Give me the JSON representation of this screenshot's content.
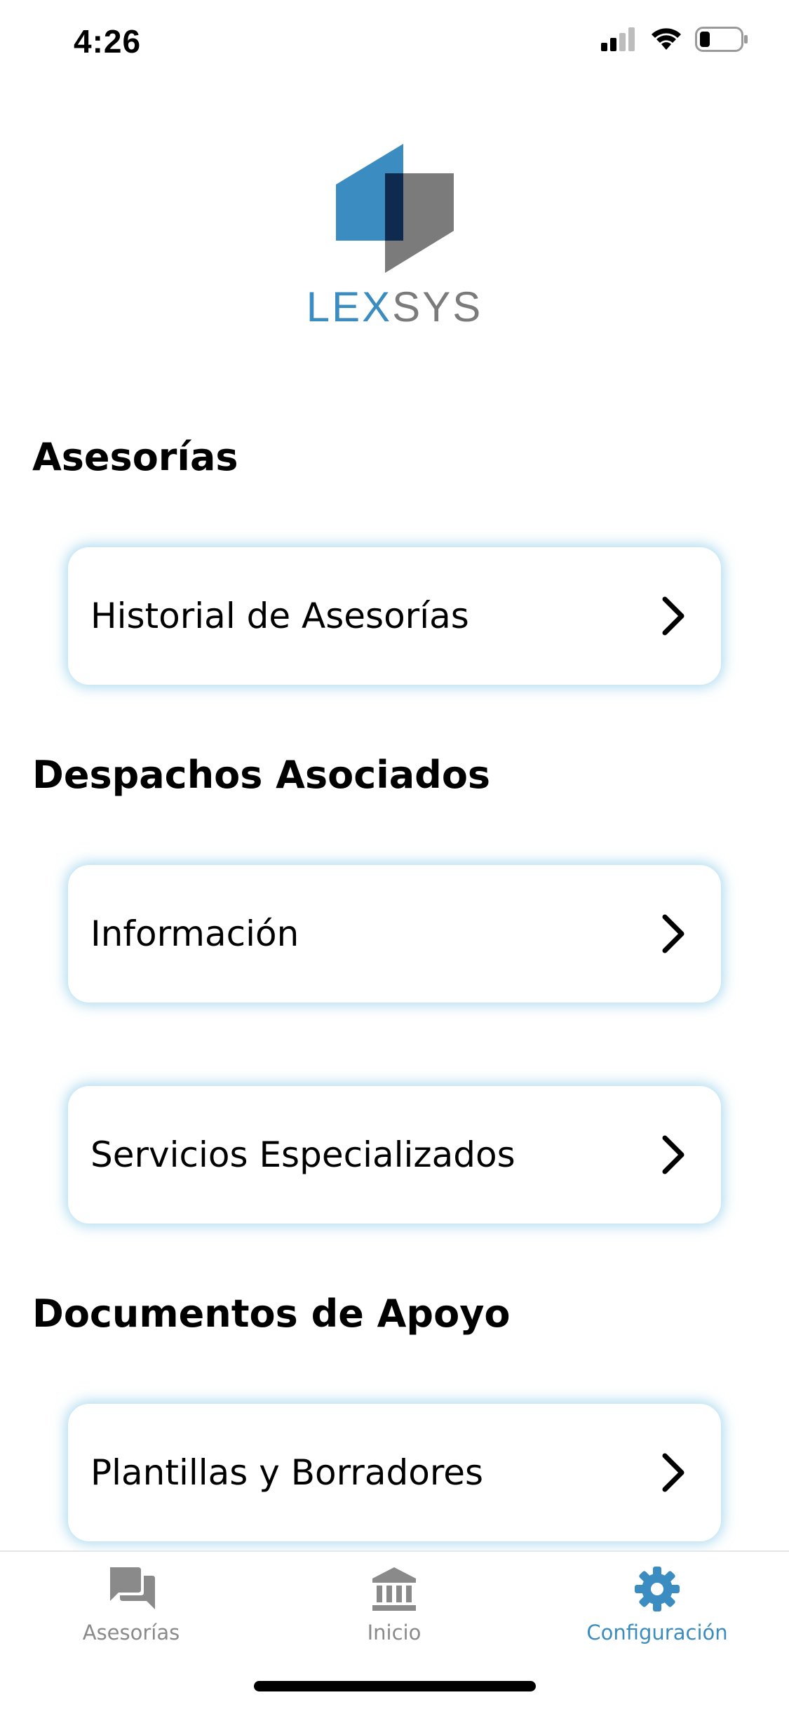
{
  "status_bar": {
    "time": "4:26",
    "icons": [
      "cellular-signal-icon",
      "wifi-icon",
      "battery-icon"
    ]
  },
  "logo": {
    "text_lex": "LEX",
    "text_sys": "SYS",
    "colors": {
      "blue": "#3a8cc1",
      "navy": "#0e2a4f",
      "gray": "#7b7b7b"
    }
  },
  "sections": [
    {
      "title": "Asesorías",
      "items": [
        {
          "label": "Historial de Asesorías",
          "icon": "chevron-right-icon"
        }
      ]
    },
    {
      "title": "Despachos Asociados",
      "items": [
        {
          "label": "Información",
          "icon": "chevron-right-icon"
        },
        {
          "label": "Servicios Especializados",
          "icon": "chevron-right-icon"
        }
      ]
    },
    {
      "title": "Documentos de Apoyo",
      "items": [
        {
          "label": "Plantillas y Borradores",
          "icon": "chevron-right-icon"
        }
      ]
    }
  ],
  "tab_bar": {
    "tabs": [
      {
        "label": "Asesorías",
        "icon": "chat-bubbles-icon",
        "active": false
      },
      {
        "label": "Inicio",
        "icon": "bank-building-icon",
        "active": false
      },
      {
        "label": "Configuración",
        "icon": "gear-icon",
        "active": true
      }
    ],
    "active_color": "#3a8cc1",
    "inactive_color": "#8a8a8a"
  }
}
